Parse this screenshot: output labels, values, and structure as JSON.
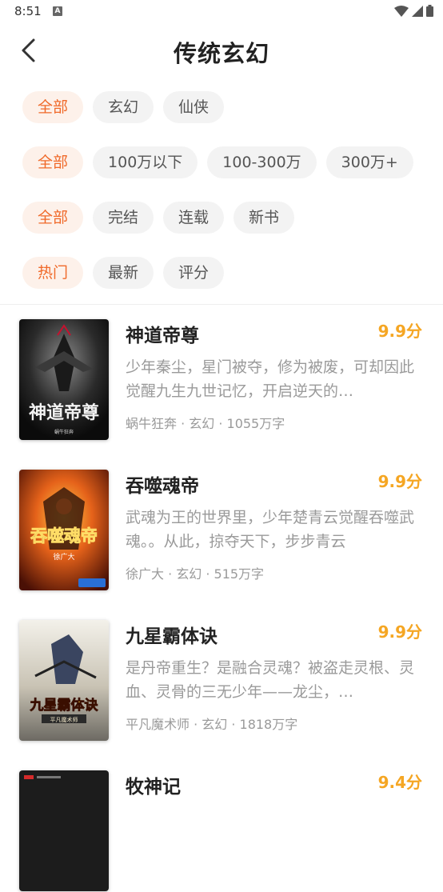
{
  "status": {
    "time": "8:51",
    "a_label": "A"
  },
  "header": {
    "title": "传统玄幻"
  },
  "filters": [
    [
      "全部",
      "玄幻",
      "仙侠"
    ],
    [
      "全部",
      "100万以下",
      "100-300万",
      "300万+"
    ],
    [
      "全部",
      "完结",
      "连载",
      "新书"
    ],
    [
      "热门",
      "最新",
      "评分"
    ]
  ],
  "books": [
    {
      "title": "神道帝尊",
      "score": "9.9分",
      "desc": "少年秦尘，星门被夺，修为被废，可却因此觉醒九生九世记忆，开启逆天的…",
      "meta": "蜗牛狂奔 · 玄幻 · 1055万字",
      "cover_text": "神道帝尊",
      "cover_sub": "蜗牛狂奔"
    },
    {
      "title": "吞噬魂帝",
      "score": "9.9分",
      "desc": "武魂为王的世界里，少年楚青云觉醒吞噬武魂。。从此，掠夺天下，步步青云",
      "meta": "徐广大 · 玄幻 · 515万字",
      "cover_text": "吞噬魂帝",
      "cover_sub": "徐广大"
    },
    {
      "title": "九星霸体诀",
      "score": "9.9分",
      "desc": "是丹帝重生？是融合灵魂？被盗走灵根、灵血、灵骨的三无少年——龙尘，…",
      "meta": "平凡魔术师 · 玄幻 · 1818万字",
      "cover_text": "九星霸体诀",
      "cover_sub": "平凡魔术师"
    },
    {
      "title": "牧神记",
      "score": "9.4分",
      "desc": "",
      "meta": "",
      "cover_text": "",
      "cover_sub": ""
    }
  ],
  "colors": {
    "accent": "#f06a2a",
    "score": "#f5a623",
    "chip_bg": "#f3f3f3",
    "chip_active_bg": "#fdf1ea"
  }
}
